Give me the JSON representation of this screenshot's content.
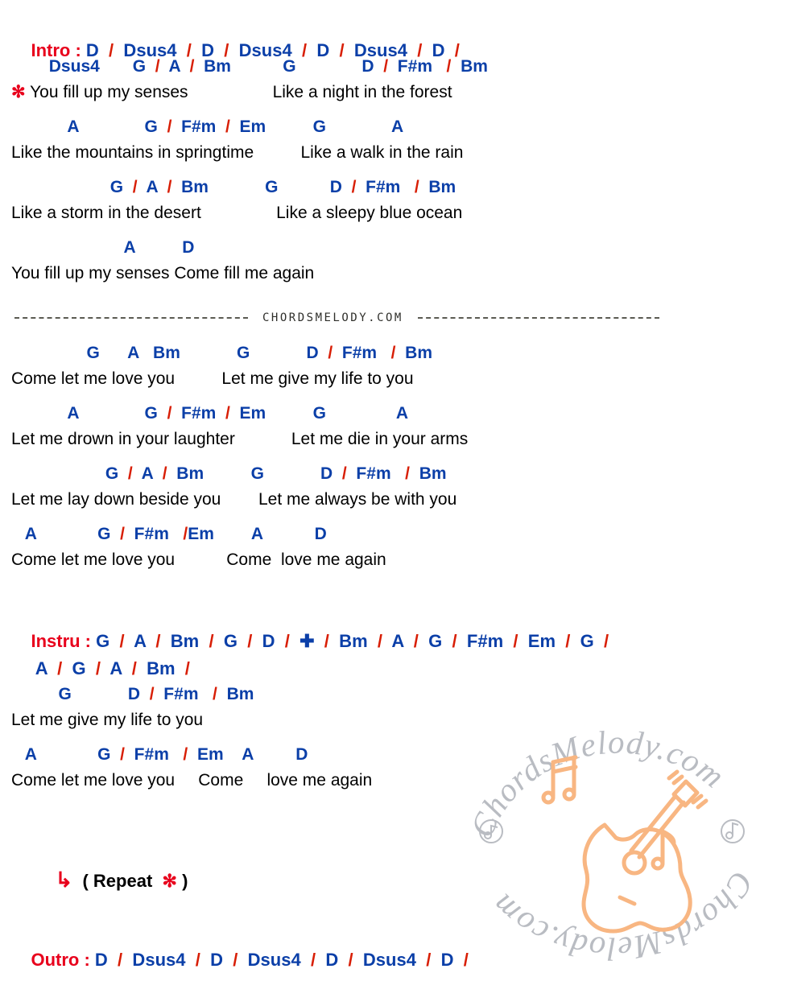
{
  "colors": {
    "chord": "#0b3fa8",
    "separator": "#d81e05",
    "section_label": "#e8001c",
    "lyric": "#000000",
    "watermark_text": "#b9bcc2",
    "watermark_art": "#f8b682"
  },
  "intro": {
    "label": "Intro :",
    "chords": "D  /  Dsus4  /  D  /  Dsus4  /  D  /  Dsus4  /  D  /"
  },
  "verse1": {
    "lines": [
      {
        "chords": "        Dsus4       G  /  A  /  Bm           G              D  /  F#m   /  Bm",
        "marker": "✻",
        "lyric": " You fill up my senses                  Like a night in the forest"
      },
      {
        "chords": "            A              G  /  F#m  /  Em          G              A",
        "marker": "",
        "lyric": "Like the mountains in springtime          Like a walk in the rain"
      },
      {
        "chords": "                     G  /  A  /  Bm            G           D  /  F#m   /  Bm",
        "marker": "",
        "lyric": "Like a storm in the desert                Like a sleepy blue ocean"
      },
      {
        "chords": "                        A          D",
        "marker": "",
        "lyric": "You fill up my senses Come fill me again"
      }
    ]
  },
  "divider": {
    "site": "CHORDSMELODY.COM"
  },
  "verse2": {
    "lines": [
      {
        "chords": "                G      A   Bm            G            D  /  F#m   /  Bm",
        "lyric": "Come let me love you          Let me give my life to you"
      },
      {
        "chords": "            A              G  /  F#m  /  Em          G               A",
        "lyric": "Let me drown in your laughter            Let me die in your arms"
      },
      {
        "chords": "                    G  /  A  /  Bm          G            D  /  F#m   /  Bm",
        "lyric": "Let me lay down beside you        Let me always be with you"
      },
      {
        "chords": "   A             G  /  F#m   /Em        A           D",
        "lyric": "Come let me love you           Come  love me again"
      }
    ]
  },
  "instru": {
    "label": "Instru :",
    "chords_line1": "G  /  A  /  Bm  /  G  /  D  /  ✚  /  Bm  /  A  /  G  /  F#m  /  Em  /  G  /",
    "chords_line2": " A  /  G  /  A  /  Bm  /"
  },
  "verse3": {
    "lines": [
      {
        "chords": "          G            D  /  F#m   /  Bm",
        "lyric": "Let me give my life to you"
      },
      {
        "chords": "   A             G  /  F#m   /  Em    A         D",
        "lyric": "Come let me love you     Come     love me again"
      }
    ]
  },
  "repeat": {
    "arrow": "↳",
    "open": "( Repeat  ",
    "star": "✻",
    "close": " )"
  },
  "outro": {
    "label": "Outro :",
    "chords": "D  /  Dsus4  /  D  /  Dsus4  /  D  /  Dsus4  /  D  /"
  },
  "watermark": {
    "text_top": "ChordsMelody.com",
    "text_bottom": "ChordsMelody.com"
  }
}
